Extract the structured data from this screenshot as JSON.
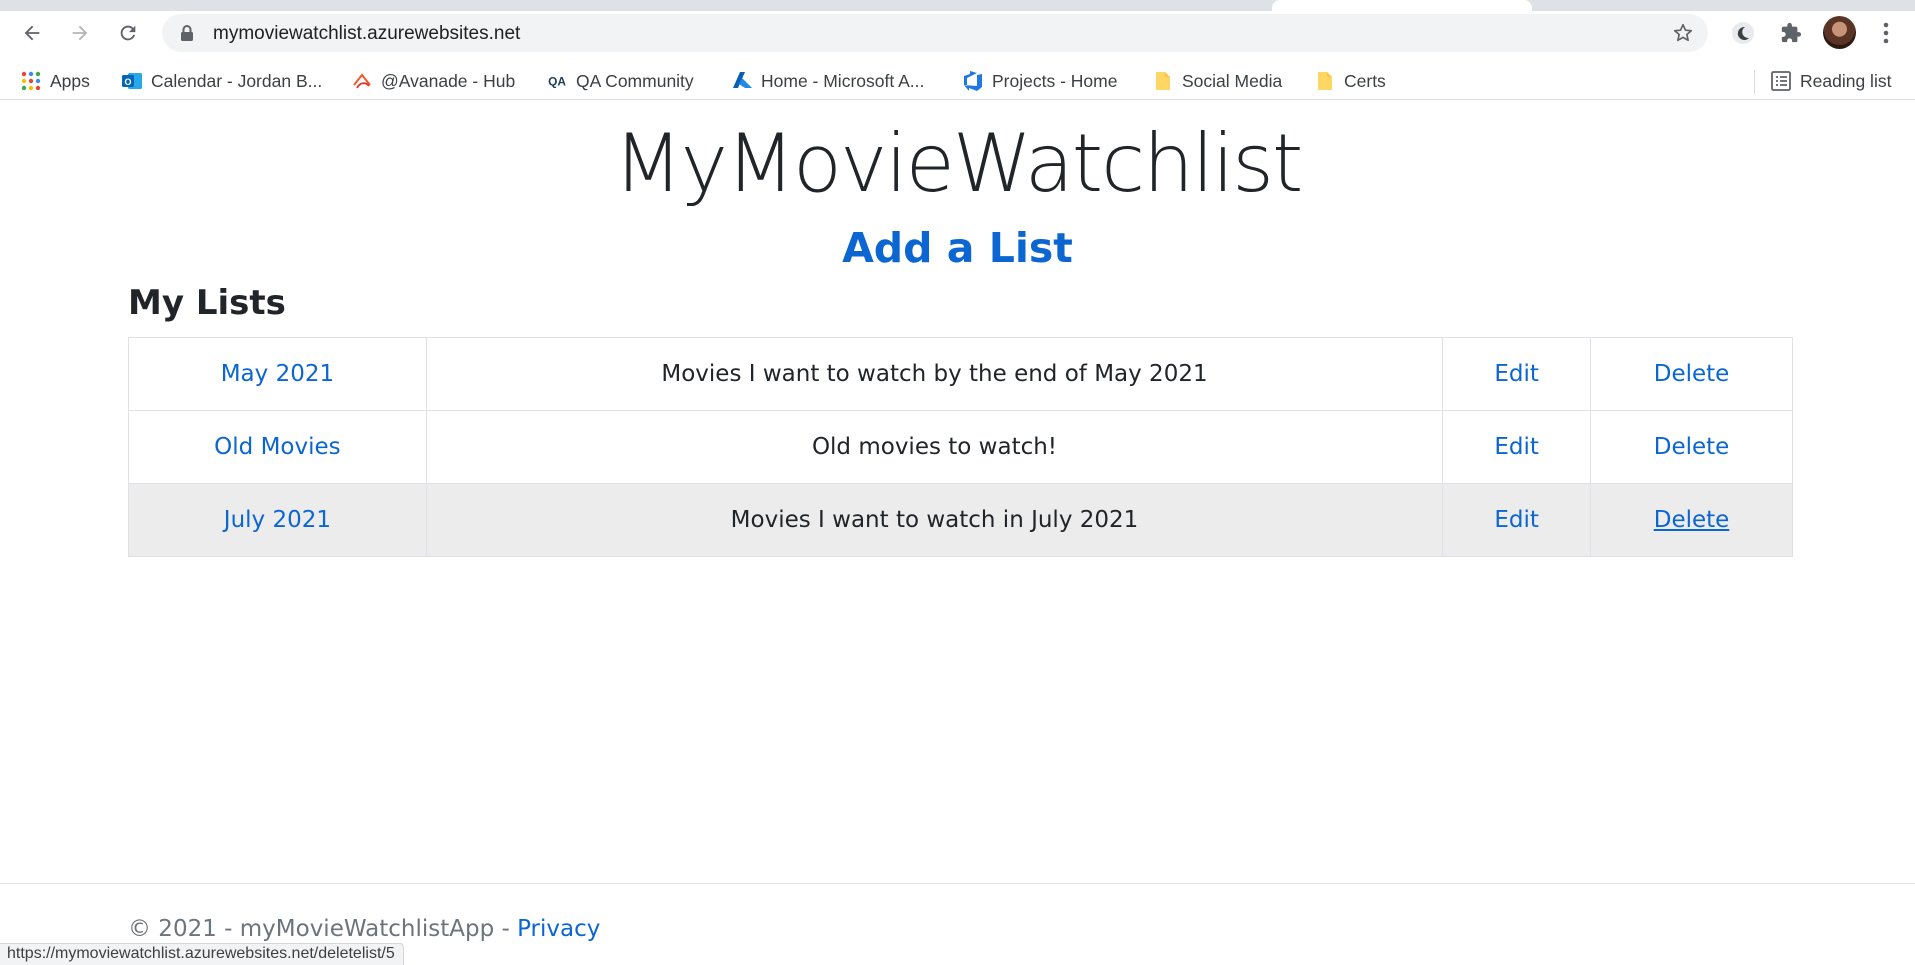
{
  "browser": {
    "url": "mymoviewatchlist.azurewebsites.net",
    "bookmarks": [
      {
        "label": "Apps",
        "icon": "apps-grid-icon"
      },
      {
        "label": "Calendar - Jordan B...",
        "icon": "outlook-icon"
      },
      {
        "label": "@Avanade - Hub",
        "icon": "avanade-icon"
      },
      {
        "label": "QA Community",
        "icon": "qa-icon"
      },
      {
        "label": "Home - Microsoft A...",
        "icon": "azure-icon"
      },
      {
        "label": "Projects - Home",
        "icon": "azure-devops-icon"
      },
      {
        "label": "Social Media",
        "icon": "folder-icon"
      },
      {
        "label": "Certs",
        "icon": "folder-icon"
      }
    ],
    "reading_list": "Reading list",
    "status_url": "https://mymoviewatchlist.azurewebsites.net/deletelist/5"
  },
  "page": {
    "title": "MyMovieWatchlist",
    "add_list": "Add a List",
    "section_title": "My Lists",
    "lists": [
      {
        "name": "May 2021",
        "description": "Movies I want to watch by the end of May 2021",
        "edit": "Edit",
        "delete": "Delete"
      },
      {
        "name": "Old Movies",
        "description": "Old movies to watch!",
        "edit": "Edit",
        "delete": "Delete"
      },
      {
        "name": "July 2021",
        "description": "Movies I want to watch in July 2021",
        "edit": "Edit",
        "delete": "Delete"
      }
    ],
    "footer": {
      "text": "© 2021 - myMovieWatchlistApp - ",
      "privacy": "Privacy"
    }
  },
  "colors": {
    "link": "#0b66d1",
    "text": "#212529",
    "muted": "#6c757d",
    "hover_row": "#ececec"
  }
}
